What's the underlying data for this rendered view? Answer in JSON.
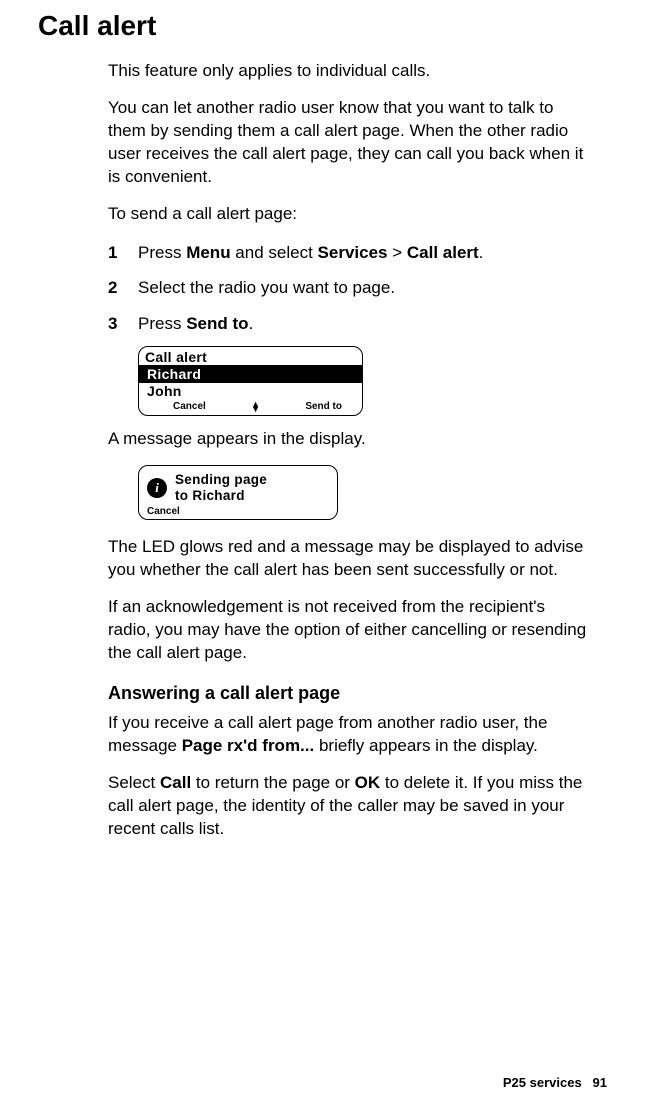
{
  "title": "Call alert",
  "intro1": "This feature only applies to individual calls.",
  "intro2": "You can let another radio user know that you want to talk to them by sending them a call alert page. When the other radio user receives the call alert page, they can call you back when it is convenient.",
  "intro3": "To send a call alert page:",
  "steps": {
    "1": {
      "num": "1",
      "pre": "Press ",
      "b1": "Menu",
      "mid1": " and select ",
      "b2": "Services",
      "mid2": " > ",
      "b3": "Call alert",
      "post": "."
    },
    "2": {
      "num": "2",
      "text": "Select the radio you want to page."
    },
    "3": {
      "num": "3",
      "pre": "Press ",
      "b1": "Send to",
      "post": "."
    }
  },
  "display1": {
    "title": "Call alert",
    "selected": "Richard",
    "item": "John",
    "softLeft": "Cancel",
    "softRight": "Send to"
  },
  "afterDisplay1": "A message appears in the display.",
  "display2": {
    "line1": "Sending page",
    "line2": "to Richard",
    "softLeft": "Cancel"
  },
  "para4": "The LED glows red and a message may be displayed to advise you whether the call alert has been sent successfully or not.",
  "para5": "If an acknowledgement is not received from the recipient's radio, you may have the option of either cancelling or resending the call alert page.",
  "subheading": "Answering a call alert page",
  "ans1": {
    "pre": "If you receive a call alert page from another radio user, the message ",
    "b1": "Page rx'd from...",
    "post": " briefly appears in the display."
  },
  "ans2": {
    "pre": "Select ",
    "b1": "Call",
    "mid1": " to return the page or ",
    "b2": "OK",
    "post": " to delete it. If you miss the call alert page, the identity of the caller may be saved in your recent calls list."
  },
  "footer": {
    "section": "P25 services",
    "page": "91"
  }
}
